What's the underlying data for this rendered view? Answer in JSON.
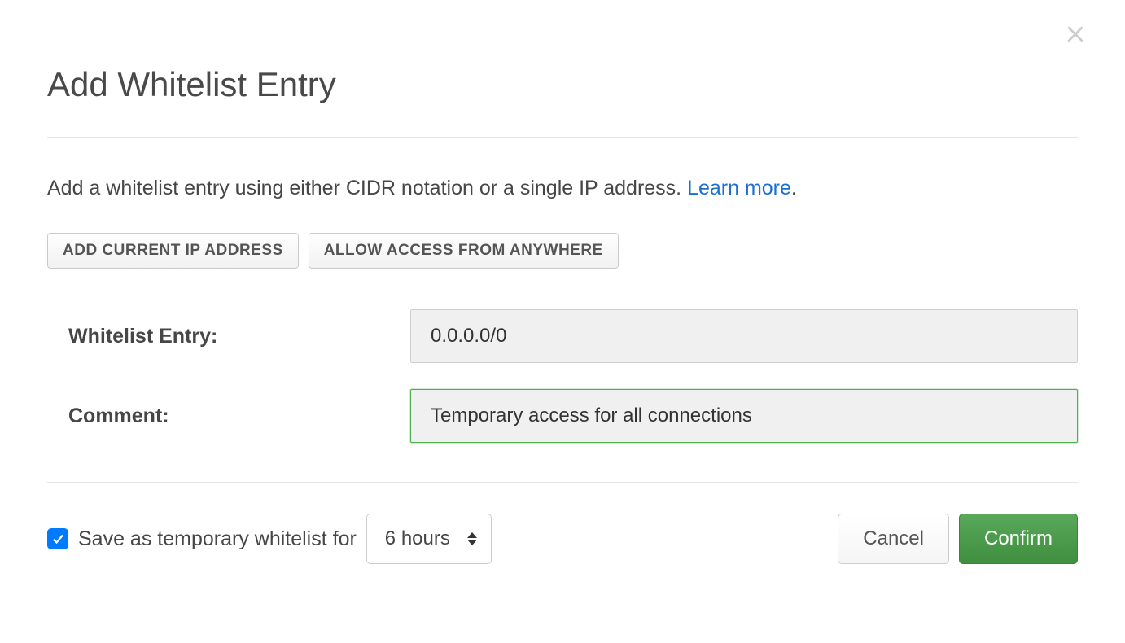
{
  "modal": {
    "title": "Add Whitelist Entry",
    "description_text": "Add a whitelist entry using either CIDR notation or a single IP address. ",
    "learn_more_label": "Learn more",
    "period": "."
  },
  "buttons": {
    "add_current_ip": "ADD CURRENT IP ADDRESS",
    "allow_anywhere": "ALLOW ACCESS FROM ANYWHERE",
    "cancel": "Cancel",
    "confirm": "Confirm"
  },
  "fields": {
    "whitelist_label": "Whitelist Entry:",
    "whitelist_value": "0.0.0.0/0",
    "comment_label": "Comment:",
    "comment_value": "Temporary access for all connections"
  },
  "footer": {
    "temporary_label": "Save as temporary whitelist for",
    "temporary_checked": true,
    "duration_selected": "6 hours"
  }
}
